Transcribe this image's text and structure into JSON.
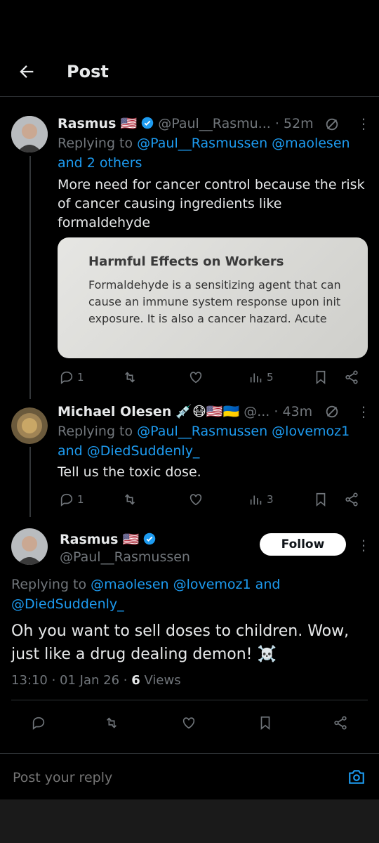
{
  "header": {
    "title": "Post"
  },
  "tweets": [
    {
      "name": "Rasmus",
      "flags": "🇺🇸",
      "handle": "@Paul__Rasmu...",
      "time": "· 52m",
      "replying_prefix": "Replying to",
      "replying_to": "@Paul__Rasmussen @maolesen",
      "replying_to_2": "and 2 others",
      "text": "More need for cancer control because the risk of cancer causing ingredients like formaldehyde",
      "media": {
        "heading": "Harmful Effects on Workers",
        "line1": "Formaldehyde is a sensitizing agent that can",
        "line2": "cause an immune system response upon init",
        "line3": "exposure. It is also a cancer hazard. Acute"
      },
      "stats": {
        "replies": "1",
        "views": "5"
      }
    },
    {
      "name": "Michael Olesen",
      "flags": "💉😷🇺🇸🇺🇦",
      "handle": "@...",
      "time": "· 43m",
      "replying_prefix": "Replying to",
      "replying_to": "@Paul__Rasmussen @lovemoz1",
      "replying_and": "and",
      "replying_to_2": "@DiedSuddenly_",
      "text": "Tell us the toxic dose.",
      "stats": {
        "replies": "1",
        "views": "3"
      }
    }
  ],
  "main_post": {
    "name": "Rasmus",
    "flag": "🇺🇸",
    "handle": "@Paul__Rasmussen",
    "follow_label": "Follow",
    "replying_prefix": "Replying to",
    "replying_to": "@maolesen @lovemoz1",
    "replying_and": "and",
    "replying_to_2": "@DiedSuddenly_",
    "text": "Oh you want to sell doses to children. Wow, just like a drug dealing demon! ☠️",
    "timestamp": "13:10 · 01 Jan 26 ·",
    "views_count": "6",
    "views_label": "Views"
  },
  "reply_bar": {
    "placeholder": "Post your reply"
  },
  "colors": {
    "accent": "#1d9bf0",
    "muted": "#71767b",
    "bg": "#000000"
  }
}
